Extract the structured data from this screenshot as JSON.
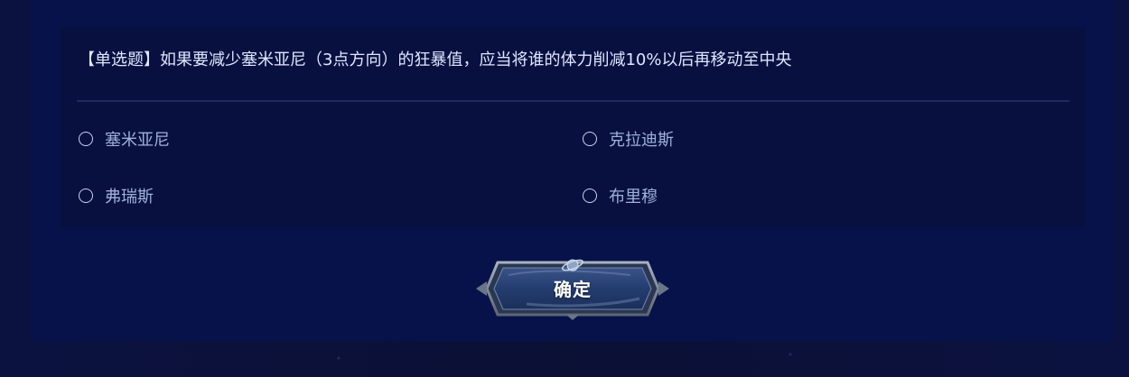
{
  "question": {
    "text": "【单选题】如果要减少塞米亚尼（3点方向）的狂暴值，应当将谁的体力削减10%以后再移动至中央"
  },
  "options": [
    {
      "label": "塞米亚尼"
    },
    {
      "label": "克拉迪斯"
    },
    {
      "label": "弗瑞斯"
    },
    {
      "label": "布里穆"
    }
  ],
  "confirm_button": {
    "label": "确定"
  },
  "colors": {
    "background": "#0b1135",
    "panel": "#08124a",
    "card": "#07103f",
    "question_text": "#dfe6ff",
    "option_text": "#9fb0d9",
    "divider": "#1b2a62"
  },
  "icons": {
    "radio": "radio-unchecked-icon",
    "button_ornament": "planet-ornament-icon"
  }
}
